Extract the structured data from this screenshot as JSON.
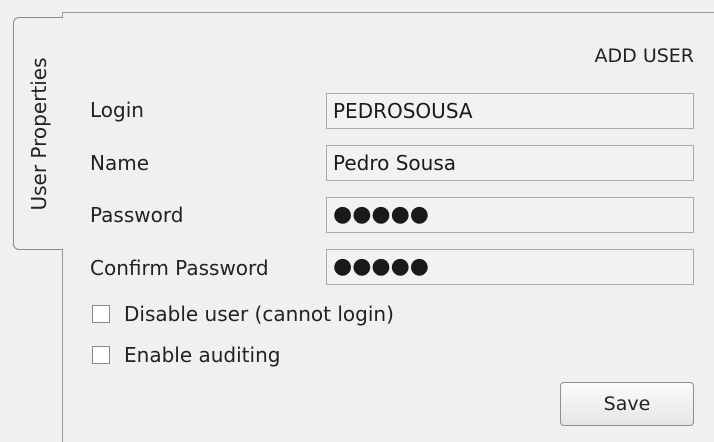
{
  "tab": {
    "label": "User Properties"
  },
  "form": {
    "title": "ADD USER",
    "login": {
      "label": "Login",
      "value": "PEDROSOUSA"
    },
    "name": {
      "label": "Name",
      "value": "Pedro Sousa"
    },
    "password": {
      "label": "Password",
      "value": "●●●●●"
    },
    "confirm_password": {
      "label": "Confirm Password",
      "value": "●●●●●"
    },
    "disable_user": {
      "label": "Disable user (cannot login)",
      "checked": false
    },
    "enable_auditing": {
      "label": "Enable auditing",
      "checked": false
    },
    "save_label": "Save"
  }
}
